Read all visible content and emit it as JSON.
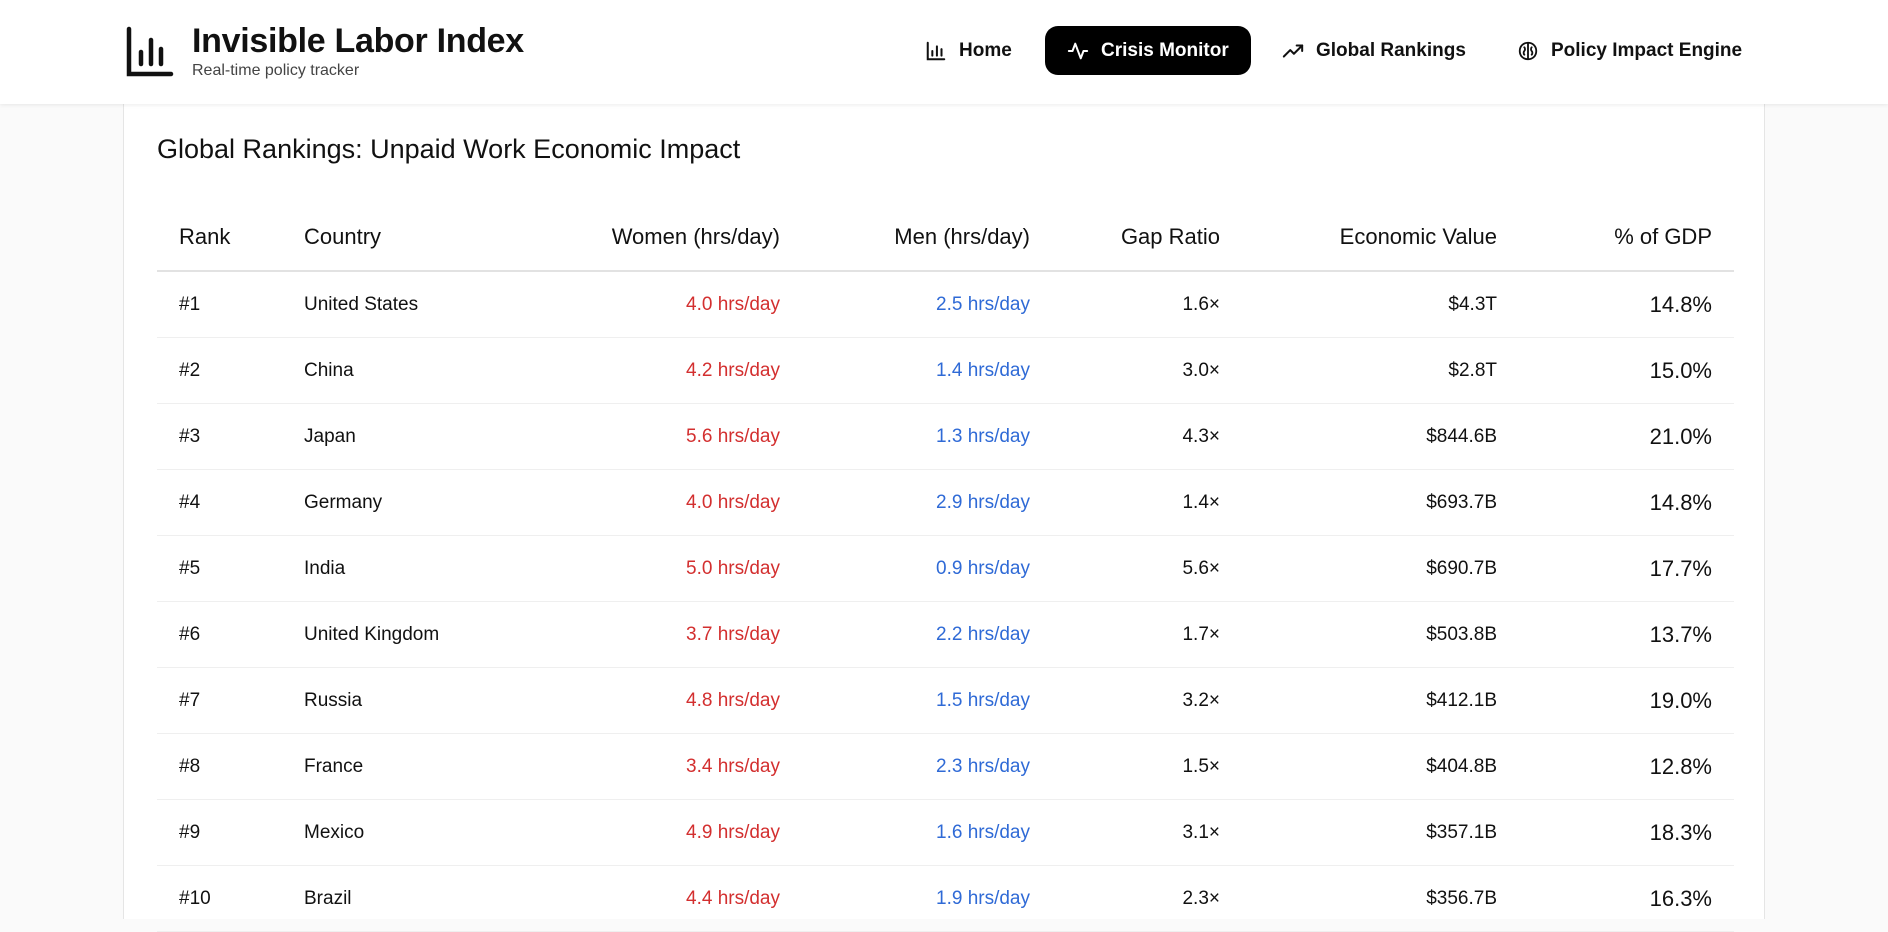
{
  "header": {
    "title": "Invisible Labor Index",
    "subtitle": "Real-time policy tracker",
    "logo_icon": "bar-chart-icon"
  },
  "nav": [
    {
      "label": "Home",
      "icon": "bar-chart-icon",
      "active": false
    },
    {
      "label": "Crisis Monitor",
      "icon": "activity-icon",
      "active": true
    },
    {
      "label": "Global Rankings",
      "icon": "trending-up-icon",
      "active": false
    },
    {
      "label": "Policy Impact Engine",
      "icon": "brain-icon",
      "active": false
    }
  ],
  "main": {
    "title": "Global Rankings: Unpaid Work Economic Impact",
    "columns": [
      "Rank",
      "Country",
      "Women (hrs/day)",
      "Men (hrs/day)",
      "Gap Ratio",
      "Economic Value",
      "% of GDP"
    ],
    "rows": [
      [
        "#1",
        "United States",
        "4.0 hrs/day",
        "2.5 hrs/day",
        "1.6×",
        "$4.3T",
        "14.8%"
      ],
      [
        "#2",
        "China",
        "4.2 hrs/day",
        "1.4 hrs/day",
        "3.0×",
        "$2.8T",
        "15.0%"
      ],
      [
        "#3",
        "Japan",
        "5.6 hrs/day",
        "1.3 hrs/day",
        "4.3×",
        "$844.6B",
        "21.0%"
      ],
      [
        "#4",
        "Germany",
        "4.0 hrs/day",
        "2.9 hrs/day",
        "1.4×",
        "$693.7B",
        "14.8%"
      ],
      [
        "#5",
        "India",
        "5.0 hrs/day",
        "0.9 hrs/day",
        "5.6×",
        "$690.7B",
        "17.7%"
      ],
      [
        "#6",
        "United Kingdom",
        "3.7 hrs/day",
        "2.2 hrs/day",
        "1.7×",
        "$503.8B",
        "13.7%"
      ],
      [
        "#7",
        "Russia",
        "4.8 hrs/day",
        "1.5 hrs/day",
        "3.2×",
        "$412.1B",
        "19.0%"
      ],
      [
        "#8",
        "France",
        "3.4 hrs/day",
        "2.3 hrs/day",
        "1.5×",
        "$404.8B",
        "12.8%"
      ],
      [
        "#9",
        "Mexico",
        "4.9 hrs/day",
        "1.6 hrs/day",
        "3.1×",
        "$357.1B",
        "18.3%"
      ],
      [
        "#10",
        "Brazil",
        "4.4 hrs/day",
        "1.9 hrs/day",
        "2.3×",
        "$356.7B",
        "16.3%"
      ]
    ]
  },
  "colors": {
    "women": "#d32f2f",
    "men": "#2f6ad6",
    "active_nav_bg": "#000000"
  }
}
